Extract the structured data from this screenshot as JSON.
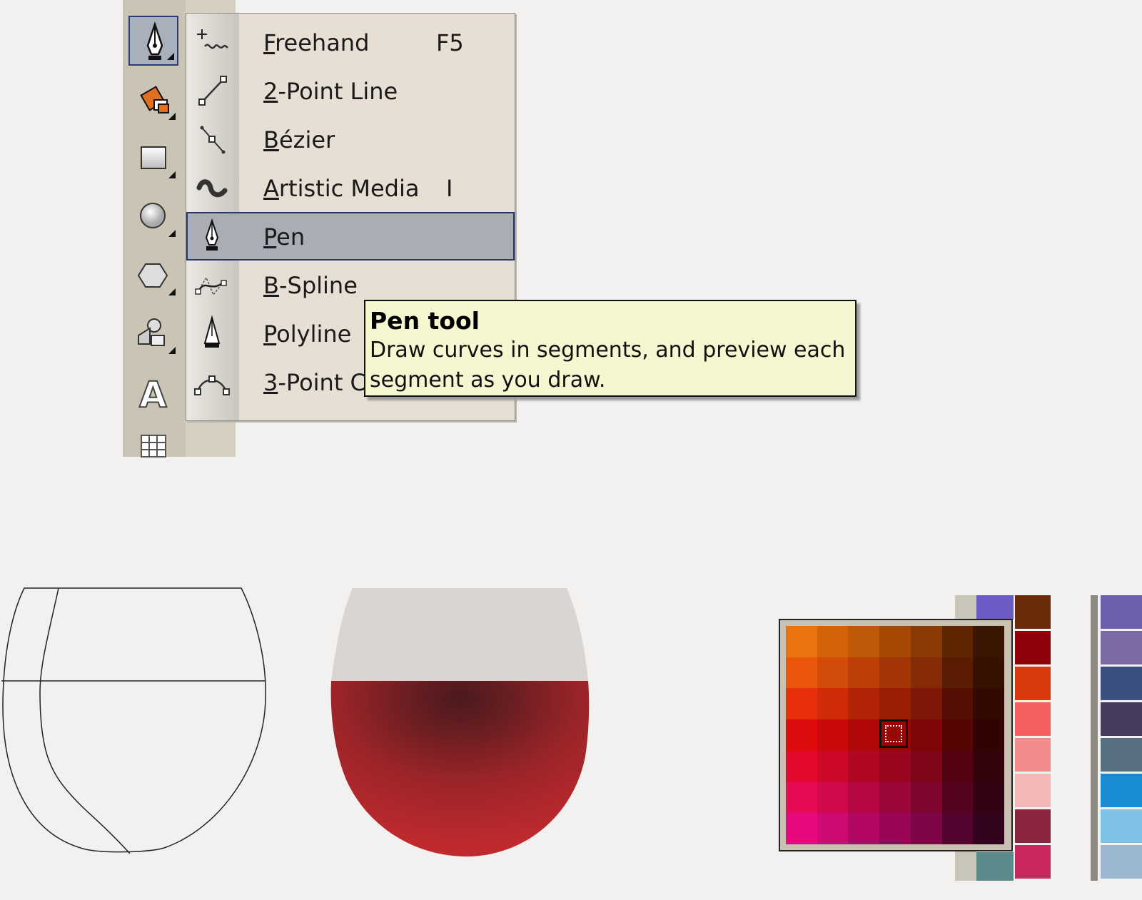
{
  "menu": {
    "items": [
      {
        "label": "Freehand",
        "shortcut": "F5",
        "icon": "freehand-icon"
      },
      {
        "label": "2-Point Line",
        "shortcut": "",
        "icon": "two-point-line-icon"
      },
      {
        "label": "Bézier",
        "shortcut": "",
        "icon": "bezier-icon"
      },
      {
        "label": "Artistic Media",
        "shortcut": "I",
        "icon": "artistic-media-icon"
      },
      {
        "label": "Pen",
        "shortcut": "",
        "icon": "pen-icon"
      },
      {
        "label": "B-Spline",
        "shortcut": "",
        "icon": "b-spline-icon"
      },
      {
        "label": "Polyline",
        "shortcut": "",
        "icon": "polyline-icon"
      },
      {
        "label": "3-Point C",
        "shortcut": "",
        "icon": "three-point-curve-icon"
      }
    ],
    "selected_index": 4
  },
  "tooltip": {
    "title": "Pen tool",
    "body": "Draw curves in segments, and preview each segment as you draw."
  },
  "colors": {
    "menu_bg": "#e8dfd4",
    "selection_bg": "#a9aeb6",
    "selection_border": "#2a3670",
    "tooltip_bg": "#f5f7d0",
    "wine": "#b8282b",
    "glass_top": "#d9d5d2"
  },
  "picker": {
    "grid": [
      [
        "#e9730c",
        "#d46409",
        "#bf5807",
        "#a74905",
        "#8b3a04",
        "#5f2603",
        "#3a1602"
      ],
      [
        "#ea560c",
        "#d44c0a",
        "#bb3f07",
        "#a33506",
        "#852b05",
        "#5a1d03",
        "#361102"
      ],
      [
        "#e9300c",
        "#d12a0a",
        "#b22307",
        "#9a1d06",
        "#7e1705",
        "#550f03",
        "#330902"
      ],
      [
        "#de0c0c",
        "#c90a0a",
        "#b00808",
        "#990707",
        "#7f0606",
        "#560404",
        "#330202"
      ],
      [
        "#e40a2e",
        "#cd0929",
        "#b20724",
        "#9a061f",
        "#7e051a",
        "#550311",
        "#33020a"
      ],
      [
        "#e80a56",
        "#d0094d",
        "#b40744",
        "#9b063b",
        "#7f0530",
        "#550320",
        "#330213"
      ],
      [
        "#e60a7e",
        "#cf0972",
        "#b30763",
        "#9a0655",
        "#7e0546",
        "#54032f",
        "#33021c"
      ]
    ],
    "palette_strip": [
      "#6a5cc4",
      "#6b2a0a",
      "#8f0008",
      "#d83a10",
      "#f46060",
      "#f28a8a",
      "#f4b8b8",
      "#8a2640",
      "#c8285c"
    ],
    "palette_right": [
      "#6c5fae",
      "#7c6aa4",
      "#3c5080",
      "#483c5c",
      "#587080",
      "#1a8cd4",
      "#7ec2e8",
      "#9cb8d0"
    ]
  }
}
